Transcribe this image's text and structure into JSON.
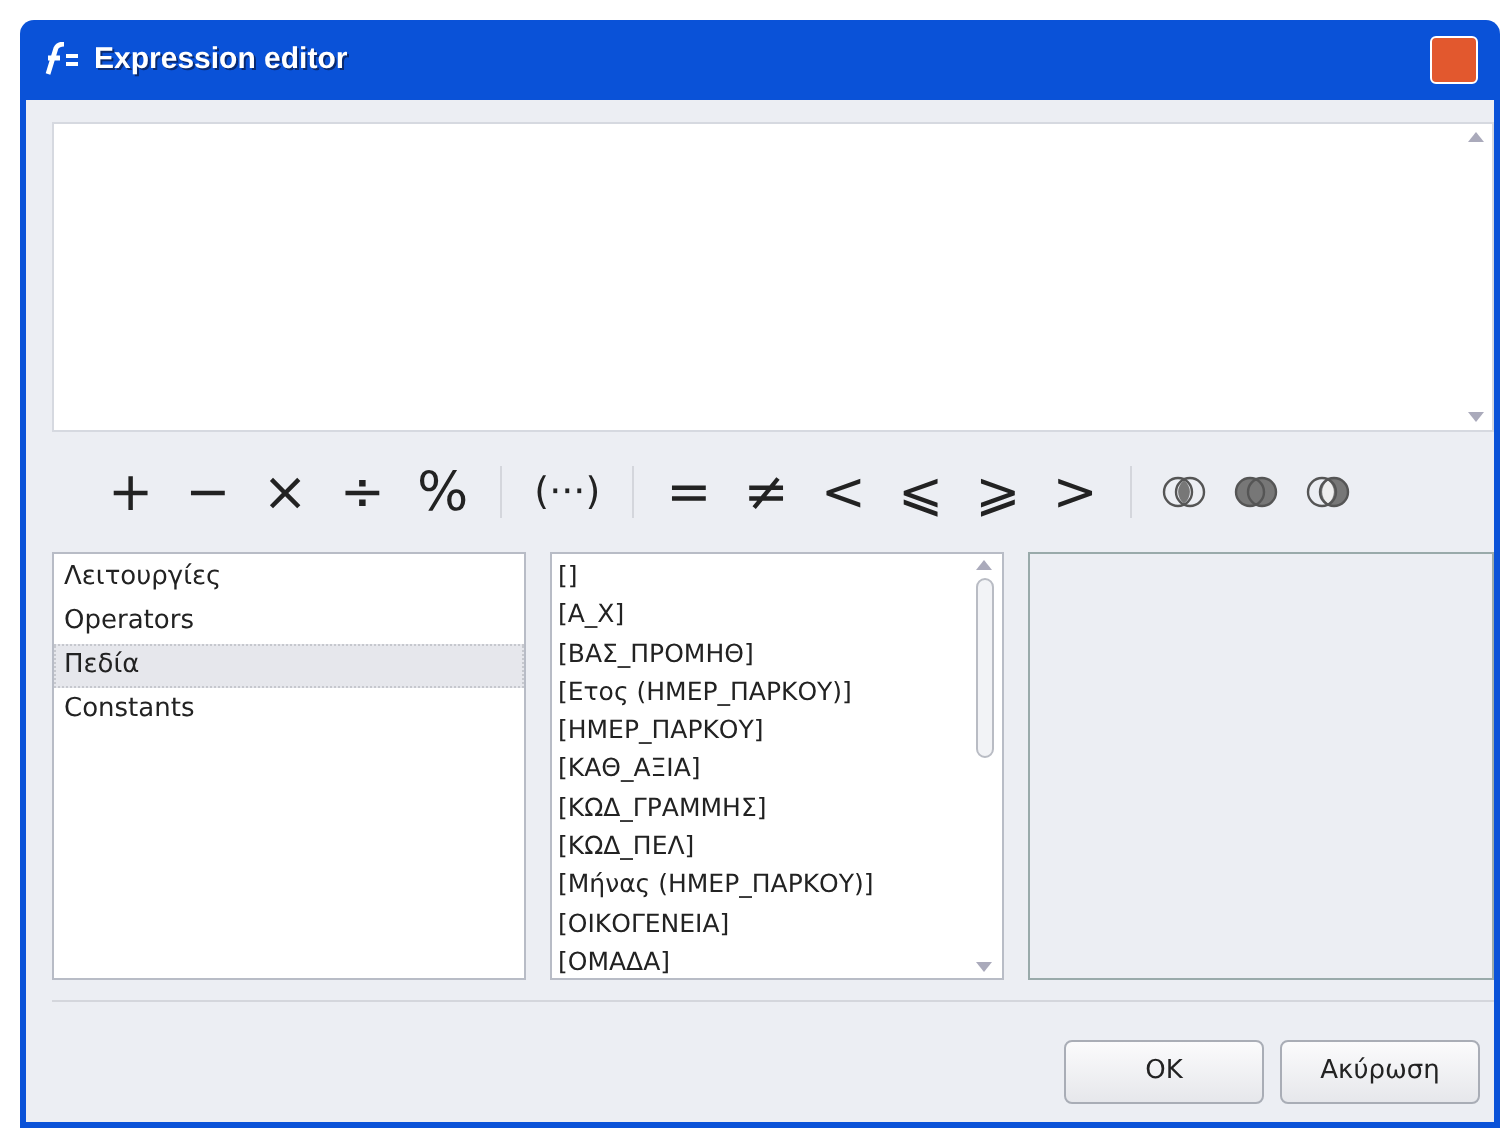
{
  "window": {
    "title": "Expression editor"
  },
  "toolbar": {
    "groups": [
      {
        "items": [
          {
            "kind": "glyph",
            "text": "+"
          },
          {
            "kind": "glyph",
            "text": "−"
          },
          {
            "kind": "glyph",
            "text": "×"
          },
          {
            "kind": "glyph",
            "text": "÷"
          },
          {
            "kind": "glyph",
            "text": "%"
          }
        ]
      },
      {
        "items": [
          {
            "kind": "glyph",
            "text": "(···)"
          }
        ]
      },
      {
        "items": [
          {
            "kind": "glyph",
            "text": "="
          },
          {
            "kind": "glyph",
            "text": "≠"
          },
          {
            "kind": "glyph",
            "text": "<"
          },
          {
            "kind": "glyph",
            "text": "⩽"
          },
          {
            "kind": "glyph",
            "text": "⩾"
          },
          {
            "kind": "glyph",
            "text": ">"
          }
        ]
      },
      {
        "items": [
          {
            "kind": "intersect"
          },
          {
            "kind": "union"
          },
          {
            "kind": "difference"
          }
        ]
      }
    ]
  },
  "categories": [
    {
      "label": "Λειτουργίες",
      "selected": false
    },
    {
      "label": "Operators",
      "selected": false
    },
    {
      "label": "Πεδία",
      "selected": true
    },
    {
      "label": "Constants",
      "selected": false
    }
  ],
  "fields": [
    "[]",
    "[Α_Χ]",
    "[ΒΑΣ_ΠΡΟΜΗΘ]",
    "[Ετος (ΗΜΕΡ_ΠΑΡΚΟΥ)]",
    "[ΗΜΕΡ_ΠΑΡΚΟΥ]",
    "[ΚΑΘ_ΑΞΙΑ]",
    "[ΚΩΔ_ΓΡΑΜΜΗΣ]",
    "[ΚΩΔ_ΠΕΛ]",
    "[Μήνας (ΗΜΕΡ_ΠΑΡΚΟΥ)]",
    "[ΟΙΚΟΓΕΝΕΙΑ]",
    "[ΟΜΑΔΑ]"
  ],
  "buttons": [
    "OK",
    "Ακύρωση"
  ]
}
